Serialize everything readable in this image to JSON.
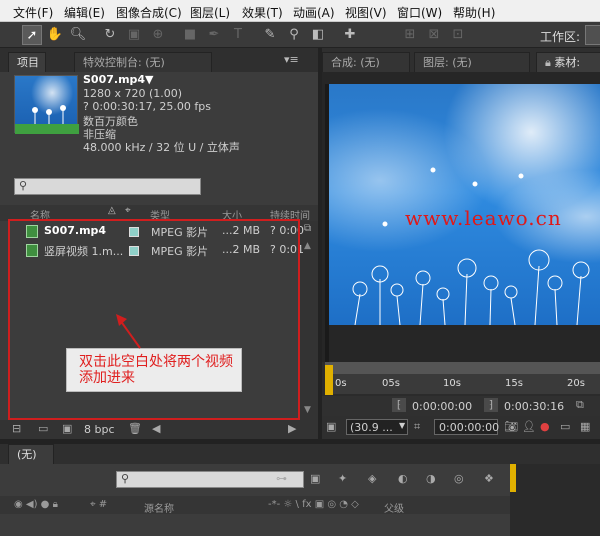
{
  "menu": [
    "文件(F)",
    "编辑(E)",
    "图像合成(C)",
    "图层(L)",
    "效果(T)",
    "动画(A)",
    "视图(V)",
    "窗口(W)",
    "帮助(H)"
  ],
  "toolbar": {
    "workspace_label": "工作区:"
  },
  "project_panel": {
    "tab_project": "项目",
    "tab_effects": "特效控制台: (无)",
    "file_name": "S007.mp4▼",
    "resolution": "1280 x 720 (1.00)",
    "duration": "? 0:00:30:17, 25.00 fps",
    "color": "数百万颜色",
    "compression": "非压缩",
    "audio": "48.000 kHz / 32 位 U / 立体声",
    "columns": {
      "name": "名称",
      "type": "类型",
      "size": "大小",
      "duration": "持续时间"
    },
    "rows": [
      {
        "name": "S007.mp4",
        "type": "MPEG 影片",
        "size": "...2 MB",
        "duration": "? 0:00"
      },
      {
        "name": "竖屏视频 1.m...",
        "type": "MPEG 影片",
        "size": "...2 MB",
        "duration": "? 0:01"
      }
    ],
    "bpc": "8 bpc"
  },
  "annotation": {
    "text": "双击此空白处将两个视频添加进来",
    "color": "#e02020"
  },
  "viewer": {
    "tab_comp": "合成: (无)",
    "tab_layer": "图层: (无)",
    "tab_footage": "素材:",
    "watermark": "www.leawo.cn",
    "ruler_marks": [
      "0s",
      "05s",
      "10s",
      "15s",
      "20s"
    ],
    "time_in": "0:00:00:00",
    "time_out": "0:00:30:16",
    "zoom": "(30.9 ...",
    "current_time": "0:00:00:00"
  },
  "timeline": {
    "tab": "(无)",
    "source_name_header": "源名称",
    "parent_header": "父级"
  },
  "colors": {
    "panel_bg": "#3c3c3c",
    "accent_highlight": "#d01e1e",
    "sky": "#2f8be0"
  }
}
